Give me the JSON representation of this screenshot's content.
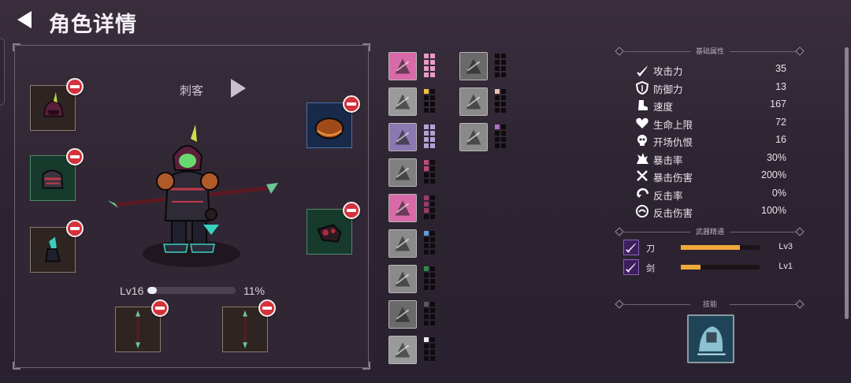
{
  "header": {
    "title": "角色详情"
  },
  "character": {
    "class_name": "刺客",
    "level": "Lv16",
    "xp_percent": "11%",
    "xp_fraction": 0.11
  },
  "equipment": {
    "left_slots": [
      "helmet",
      "armor",
      "boots"
    ],
    "right_slots": [
      "cap",
      "gauntlet"
    ],
    "bottom_slots": [
      "spear-left",
      "spear-right"
    ]
  },
  "cards": {
    "col1": [
      {
        "name": "boots-card",
        "bg": "#d86aa8",
        "pips": [
          "#e99bc8",
          "#e99bc8",
          "#e99bc8",
          "#e99bc8",
          "#e99bc8",
          "#e99bc8",
          "#e99bc8",
          "#e99bc8"
        ]
      },
      {
        "name": "hooded-figure-card",
        "bg": "#9a9a9a",
        "pips": [
          "#f0c040",
          "#0e0b0e",
          "#0e0b0e",
          "#0e0b0e",
          "#0e0b0e",
          "#0e0b0e",
          "#0e0b0e",
          "#0e0b0e"
        ]
      },
      {
        "name": "warrior-card",
        "bg": "#8a78b0",
        "pips": [
          "#b0a4d6",
          "#b0a4d6",
          "#b0a4d6",
          "#b0a4d6",
          "#b0a4d6",
          "#b0a4d6",
          "#b0a4d6",
          "#b0a4d6"
        ]
      },
      {
        "name": "claw-slash-card",
        "bg": "#808080",
        "pips": [
          "#c04a7a",
          "#0e0b0e",
          "#c04a7a",
          "#0e0b0e",
          "#0e0b0e",
          "#0e0b0e",
          "#0e0b0e",
          "#0e0b0e"
        ]
      },
      {
        "name": "crossed-blades-card",
        "bg": "#d86aa8",
        "pips": [
          "#9a3a6a",
          "#0e0b0e",
          "#9a3a6a",
          "#0e0b0e",
          "#9a3a6a",
          "#0e0b0e",
          "#0e0b0e",
          "#0e0b0e"
        ]
      },
      {
        "name": "golem-card",
        "bg": "#8a8a8a",
        "pips": [
          "#5aa0d8",
          "#0e0b0e",
          "#0e0b0e",
          "#0e0b0e",
          "#0e0b0e",
          "#0e0b0e",
          "#0e0b0e",
          "#0e0b0e"
        ]
      },
      {
        "name": "trap-card",
        "bg": "#8a8a8a",
        "pips": [
          "#2f8a4a",
          "#0e0b0e",
          "#0e0b0e",
          "#0e0b0e",
          "#0e0b0e",
          "#0e0b0e",
          "#0e0b0e",
          "#0e0b0e"
        ]
      },
      {
        "name": "shadow-card",
        "bg": "#6a6a6a",
        "pips": [
          "#5a5a5a",
          "#0e0b0e",
          "#0e0b0e",
          "#0e0b0e",
          "#0e0b0e",
          "#0e0b0e",
          "#0e0b0e",
          "#0e0b0e"
        ]
      },
      {
        "name": "mask-card",
        "bg": "#9a9a9a",
        "pips": [
          "#e8f0f8",
          "#0e0b0e",
          "#0e0b0e",
          "#0e0b0e",
          "#0e0b0e",
          "#0e0b0e",
          "#0e0b0e",
          "#0e0b0e"
        ]
      }
    ],
    "col2": [
      {
        "name": "dark-spirit-card",
        "bg": "#6a6a6a",
        "pips": [
          "#0e0b0e",
          "#0e0b0e",
          "#0e0b0e",
          "#0e0b0e",
          "#0e0b0e",
          "#0e0b0e",
          "#0e0b0e",
          "#0e0b0e"
        ]
      },
      {
        "name": "beast-card",
        "bg": "#8a8a8a",
        "pips": [
          "#e8c0b0",
          "#0e0b0e",
          "#0e0b0e",
          "#0e0b0e",
          "#0e0b0e",
          "#0e0b0e",
          "#0e0b0e",
          "#0e0b0e"
        ]
      },
      {
        "name": "fist-card",
        "bg": "#8a8a8a",
        "pips": [
          "#b070c0",
          "#0e0b0e",
          "#0e0b0e",
          "#0e0b0e",
          "#0e0b0e",
          "#0e0b0e",
          "#0e0b0e",
          "#0e0b0e"
        ]
      }
    ]
  },
  "stats": {
    "section_title": "基础属性",
    "items": [
      {
        "label": "攻击力",
        "value": "35",
        "icon": "sword-icon"
      },
      {
        "label": "防御力",
        "value": "13",
        "icon": "shield-icon"
      },
      {
        "label": "速度",
        "value": "167",
        "icon": "boot-icon"
      },
      {
        "label": "生命上限",
        "value": "72",
        "icon": "heart-icon"
      },
      {
        "label": "开场仇恨",
        "value": "16",
        "icon": "skull-icon"
      },
      {
        "label": "暴击率",
        "value": "30%",
        "icon": "burst-icon"
      },
      {
        "label": "暴击伤害",
        "value": "200%",
        "icon": "crossed-swords-icon"
      },
      {
        "label": "反击率",
        "value": "0%",
        "icon": "counter-icon"
      },
      {
        "label": "反击伤害",
        "value": "100%",
        "icon": "swirl-icon"
      }
    ]
  },
  "mastery": {
    "section_title": "武器精通",
    "items": [
      {
        "label": "刀",
        "level": "Lv3",
        "fraction": 0.75
      },
      {
        "label": "剑",
        "level": "Lv1",
        "fraction": 0.25
      }
    ]
  },
  "skills": {
    "section_title": "技能"
  }
}
